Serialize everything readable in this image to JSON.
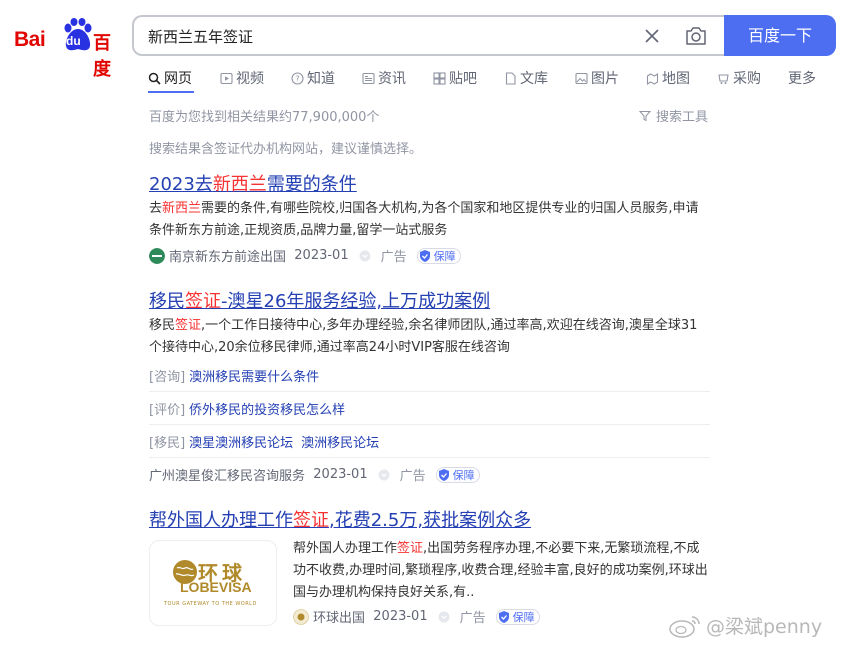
{
  "logo": {
    "bai": "Bai",
    "du": "du",
    "cn": "百度"
  },
  "search": {
    "query": "新西兰五年签证",
    "button_label": "百度一下"
  },
  "tabs": [
    {
      "label": "网页",
      "icon": "search-icon"
    },
    {
      "label": "视频",
      "icon": "video-icon"
    },
    {
      "label": "知道",
      "icon": "question-icon"
    },
    {
      "label": "资讯",
      "icon": "news-icon"
    },
    {
      "label": "贴吧",
      "icon": "tieba-icon"
    },
    {
      "label": "文库",
      "icon": "document-icon"
    },
    {
      "label": "图片",
      "icon": "image-icon"
    },
    {
      "label": "地图",
      "icon": "map-icon"
    },
    {
      "label": "采购",
      "icon": "cart-icon"
    },
    {
      "label": "更多",
      "icon": ""
    }
  ],
  "stats": {
    "text": "百度为您找到相关结果约77,900,000个",
    "tools": "搜索工具",
    "notice": "搜索结果含签证代办机构网站，建议谨慎选择。"
  },
  "results": [
    {
      "title_a": "2023去",
      "title_hl": "新西兰",
      "title_b": "需要的条件",
      "desc_a": "去",
      "desc_hl": "新西兰",
      "desc_b": "需要的条件,有哪些院校,归国各大机构,为各个国家和地区提供专业的归国人员服务,申请条件新东方前途,正规资质,品牌力量,留学一站式服务",
      "source": "南京新东方前途出国",
      "date": "2023-01",
      "ad": "广告",
      "guard": "保障"
    },
    {
      "title_a": "移民",
      "title_hl": "签证",
      "title_b": "-澳星26年服务经验,上万成功案例",
      "desc_a": "移民",
      "desc_hl": "签证",
      "desc_b": ",一个工作日接待中心,多年办理经验,余名律师团队,通过率高,欢迎在线咨询,澳星全球31个接待中心,20余位移民律师,通过率高24小时VIP客服在线咨询",
      "sublinks": [
        {
          "cat": "[咨询]",
          "links": [
            "澳洲移民需要什么条件"
          ]
        },
        {
          "cat": "[评价]",
          "links": [
            "侨外移民的投资移民怎么样"
          ]
        },
        {
          "cat": "[移民]",
          "links": [
            "澳星澳洲移民论坛",
            "澳洲移民论坛"
          ]
        }
      ],
      "source": "广州澳星俊汇移民咨询服务",
      "date": "2023-01",
      "ad": "广告",
      "guard": "保障"
    },
    {
      "title_a": "帮外国人办理工作",
      "title_hl": "签证",
      "title_b": ",花费2.5万,获批案例众多",
      "desc_a": "帮外国人办理工作",
      "desc_hl": "签证",
      "desc_b": ",出国劳务程序办理,不必要下来,无繁琐流程,不成功不收费,办理时间,繁琐程序,收费合理,经验丰富,良好的成功案例,环球出国与办理机构保持良好关系,有..",
      "thumb": {
        "cn": "环球",
        "en": "LOBEVISA",
        "tagline": "TOUR GATEWAY TO THE WORLD"
      },
      "source": "环球出国",
      "date": "2023-01",
      "ad": "广告",
      "guard": "保障"
    }
  ],
  "watermark": "@梁斌penny",
  "colors": {
    "brand_blue": "#4e6ef2",
    "link": "#2440b3",
    "highlight": "#f73131",
    "logo_red": "#e10601"
  }
}
